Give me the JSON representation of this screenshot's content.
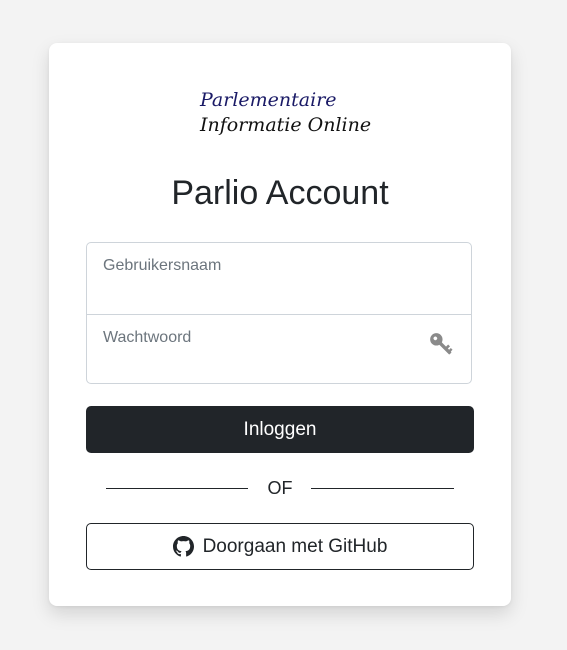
{
  "logo": {
    "line1": "Parlementaire",
    "line2": "Informatie Online"
  },
  "title": "Parlio Account",
  "form": {
    "username_placeholder": "Gebruikersnaam",
    "password_placeholder": "Wachtwoord",
    "login_label": "Inloggen"
  },
  "divider": {
    "label": "OF"
  },
  "github": {
    "label": "Doorgaan met GitHub",
    "icon": "github-icon"
  },
  "colors": {
    "page_background": "#f3f3f3",
    "card_background": "#ffffff",
    "primary_button": "#212529",
    "logo_accent": "#1a1a66",
    "key_icon": "#888888"
  }
}
